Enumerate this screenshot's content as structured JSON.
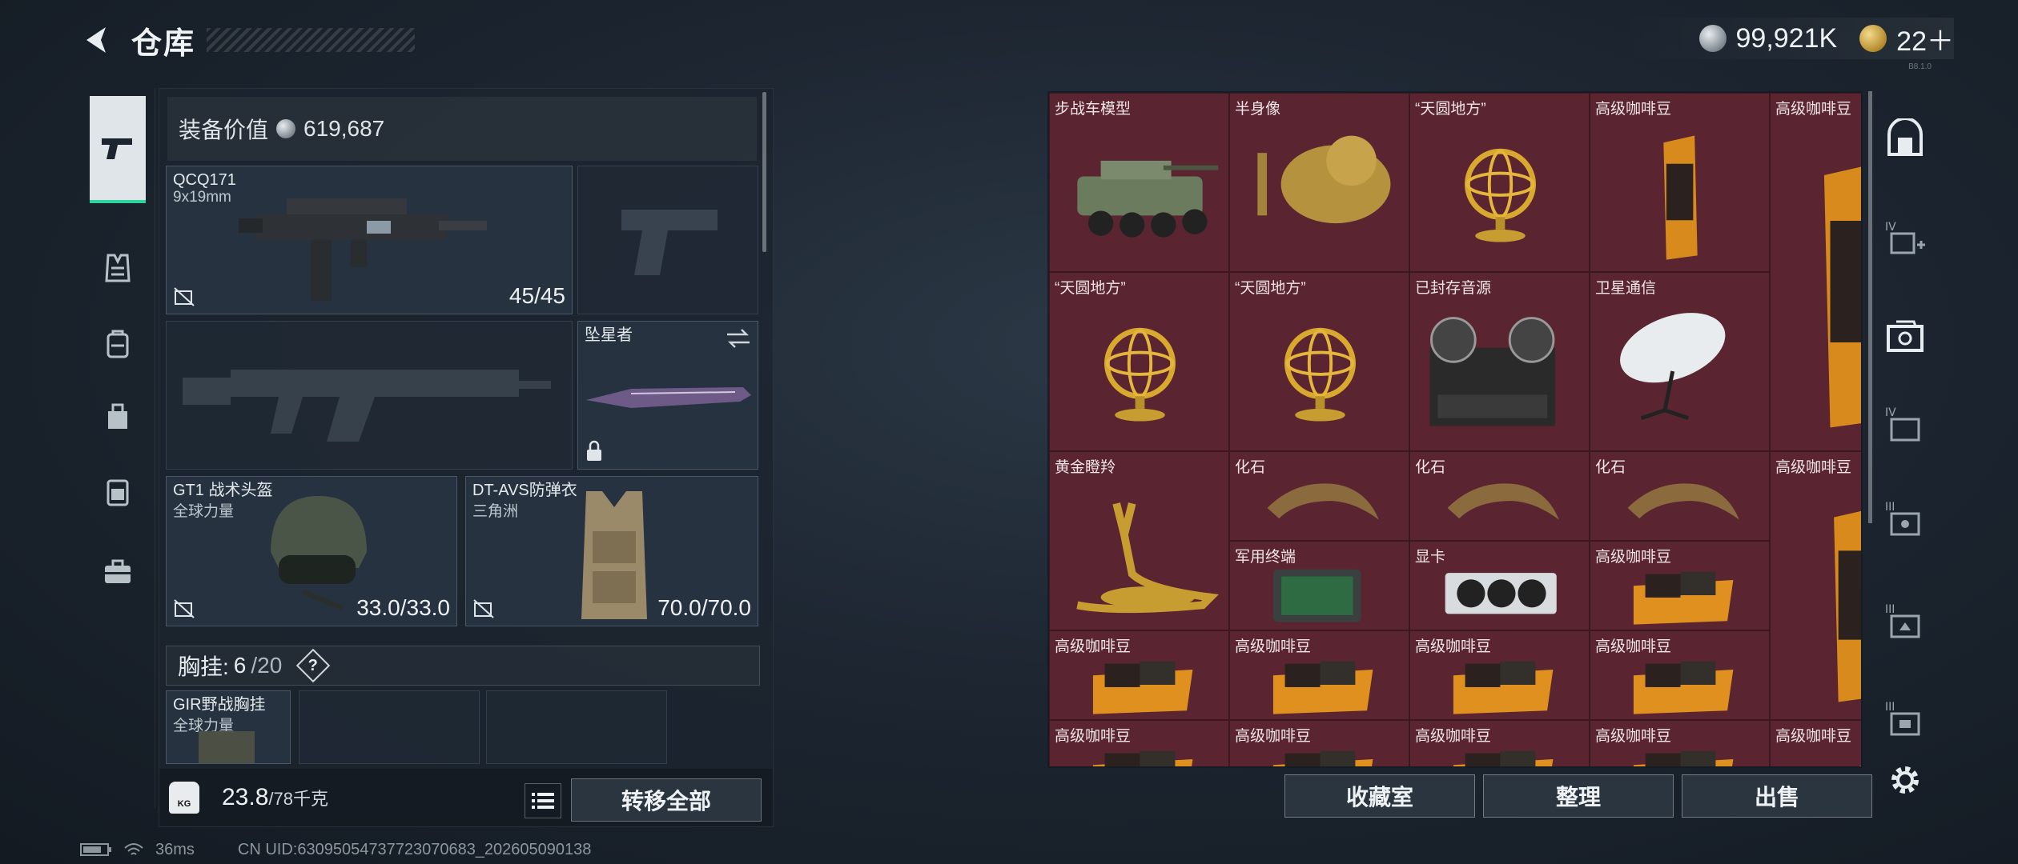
{
  "header": {
    "title": "仓库",
    "currency_silver": "99,921K",
    "currency_gold": "22＋",
    "version": "B8.1.0"
  },
  "left_nav": {
    "items": [
      "weapon-icon",
      "armor-icon",
      "backpack-icon",
      "bag-icon",
      "chest-rig-icon",
      "case-icon"
    ]
  },
  "equipment": {
    "value_label": "装备价值",
    "value": "619,687",
    "primary_weapon": {
      "name": "QCQ171",
      "ammo": "9x19mm",
      "durability": "45/45"
    },
    "melee": {
      "name": "坠星者"
    },
    "helmet": {
      "name": "GT1 战术头盔",
      "brand": "全球力量",
      "durability": "33.0/33.0"
    },
    "armor": {
      "name": "DT-AVS防弹衣",
      "brand": "三角洲",
      "durability": "70.0/70.0"
    },
    "chest_rig": {
      "label": "胸挂:",
      "used": "6",
      "capacity": "/20",
      "help": "?"
    },
    "chest_item": {
      "name": "GIR野战胸挂",
      "brand": "全球力量"
    },
    "weight": {
      "current": "23.8",
      "max": "/78千克"
    },
    "kg": "KG",
    "transfer_all": "转移全部"
  },
  "storage": {
    "cells": [
      {
        "label": "步战车模型",
        "img": "ifv"
      },
      {
        "label": "半身像",
        "img": "bust"
      },
      {
        "label": "“天圆地方”",
        "img": "globe"
      },
      {
        "label": "高级咖啡豆",
        "img": "coffee"
      },
      {
        "label": "“天圆地方”",
        "img": "globe"
      },
      {
        "label": "“天圆地方”",
        "img": "globe"
      },
      {
        "label": "已封存音源",
        "img": "recorder"
      },
      {
        "label": "卫星通信",
        "img": "dish"
      },
      {
        "label": "高级咖啡豆",
        "img": "coffee"
      },
      {
        "label": "黄金瞪羚",
        "img": "gazelle"
      },
      {
        "label": "化石",
        "img": "claw"
      },
      {
        "label": "化石",
        "img": "claw"
      },
      {
        "label": "化石",
        "img": "claw"
      },
      {
        "label": "高级咖啡豆",
        "img": "coffee"
      },
      {
        "label": "军用终端",
        "img": "terminal"
      },
      {
        "label": "显卡",
        "img": "gpu"
      },
      {
        "label": "高级咖啡豆",
        "img": "coffeebag"
      },
      {
        "label": "高级咖啡豆",
        "img": "coffeebag"
      },
      {
        "label": "高级咖啡豆",
        "img": "coffeebag"
      },
      {
        "label": "高级咖啡豆",
        "img": "coffeebag"
      },
      {
        "label": "高级咖啡豆",
        "img": "coffeebag"
      },
      {
        "label": "高级咖啡豆",
        "img": "coffee"
      },
      {
        "label": "高级咖啡豆",
        "img": "coffeebag"
      },
      {
        "label": "高级咖啡豆",
        "img": "coffeebag"
      },
      {
        "label": "高级咖啡豆",
        "img": "coffeebag"
      },
      {
        "label": "高级咖啡豆",
        "img": "coffeebag"
      }
    ],
    "buttons": {
      "collection": "收藏室",
      "sort": "整理",
      "sell": "出售"
    }
  },
  "right_rail": {
    "items": [
      "vault-icon",
      "iv-add-icon",
      "camera-case-icon",
      "iv-folder-icon",
      "iii-case-icon",
      "iii-bag-icon",
      "iii-box-icon",
      "settings-icon"
    ]
  },
  "status": {
    "ping": "36ms",
    "uid": "CN UID:63095054737723070683_202605090138"
  },
  "colors": {
    "accent": "#2fd39b",
    "cell_bg": "#5a2530"
  }
}
